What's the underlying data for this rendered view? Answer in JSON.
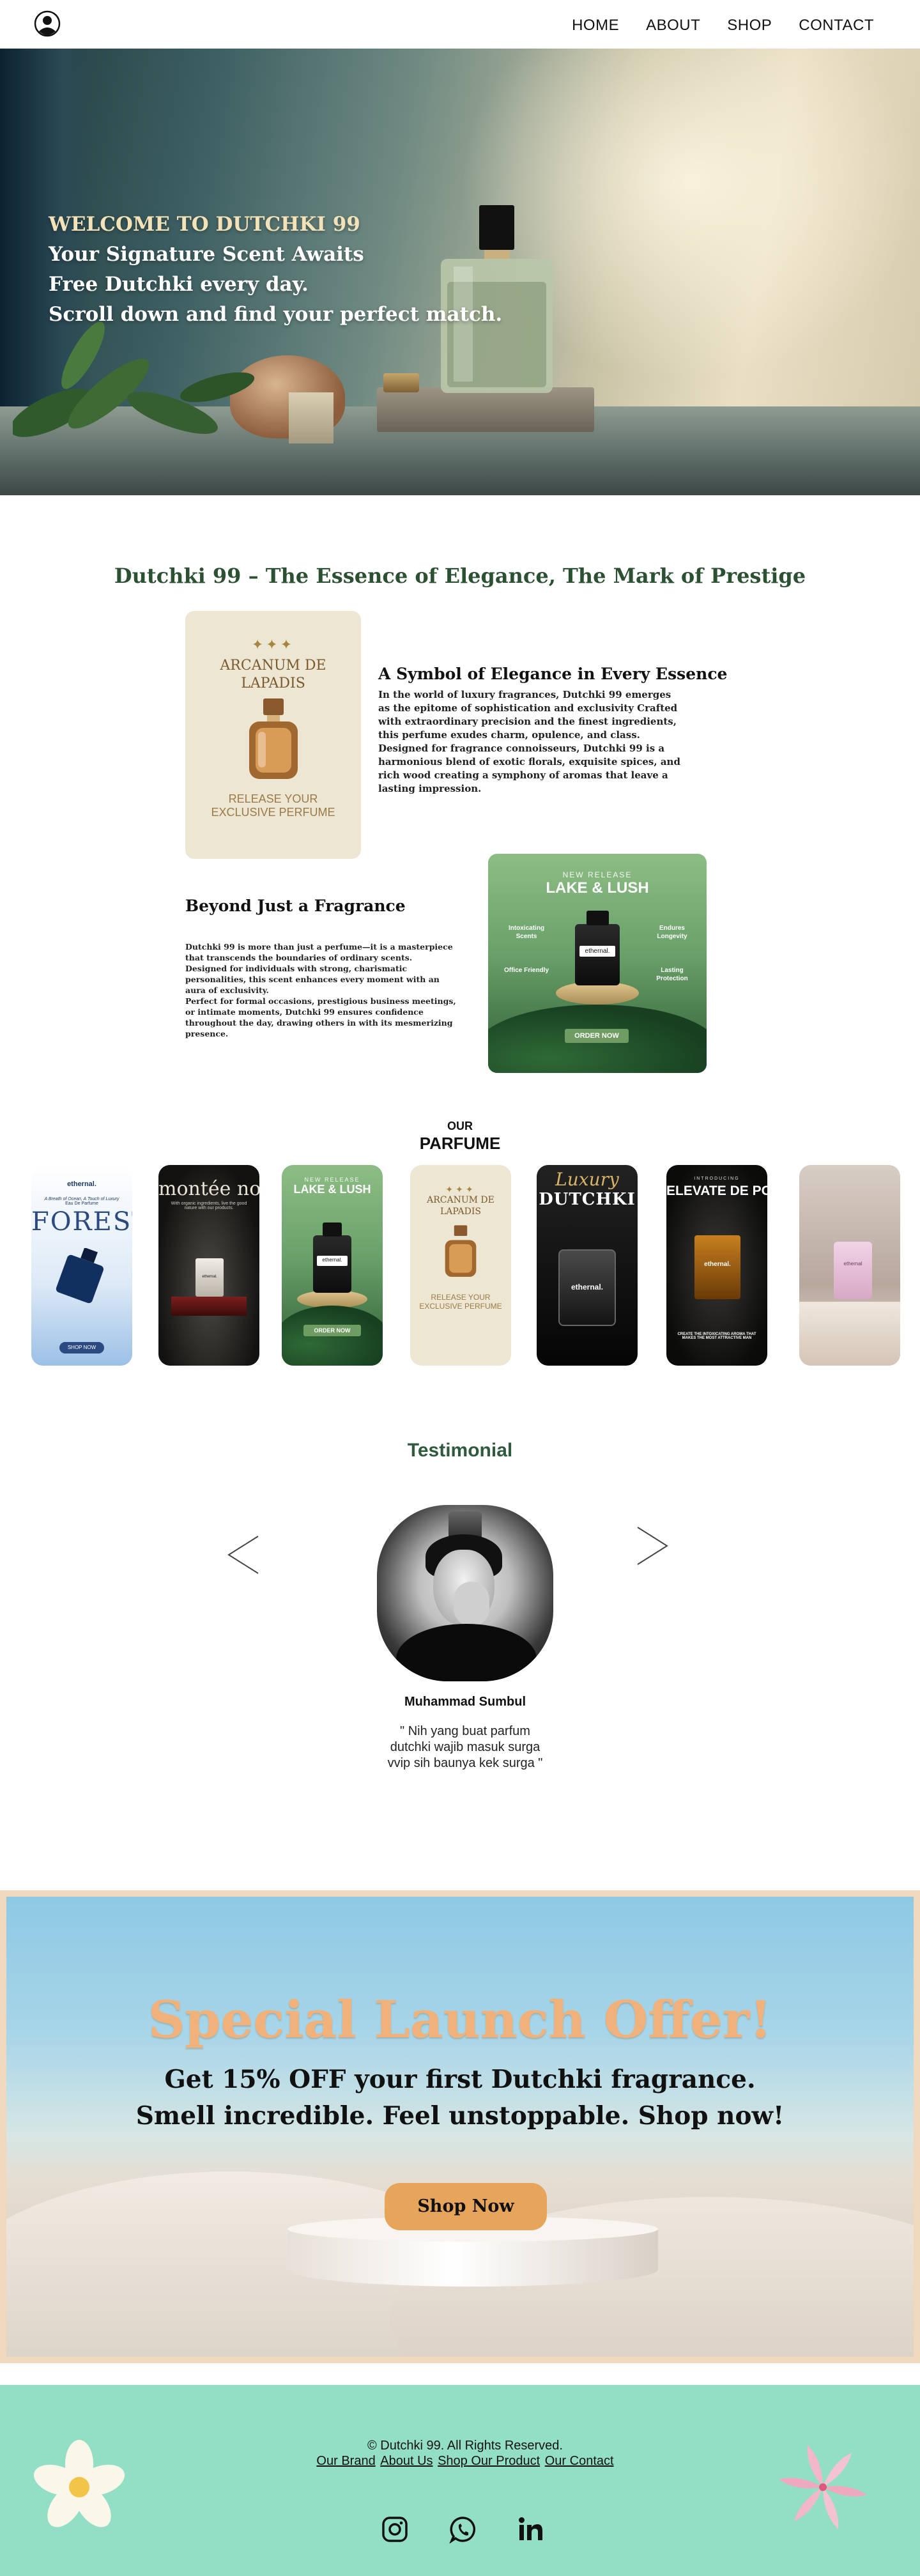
{
  "nav": {
    "items": [
      "HOME",
      "ABOUT",
      "SHOP",
      "CONTACT"
    ]
  },
  "hero": {
    "welcome": "WELCOME TO DUTCHKI 99",
    "line1": "Your Signature Scent Awaits",
    "line2": "Free Dutchki every day.",
    "line3": "Scroll down and find your perfect match."
  },
  "intro": {
    "title": "Dutchki 99 – The Essence of Elegance, The Mark of Prestige",
    "arcanum_card": {
      "stars": "✦✦✦",
      "name_line1": "ARCANUM DE",
      "name_line2": "LAPADIS",
      "tag_line1": "RELEASE YOUR",
      "tag_line2": "EXCLUSIVE PERFUME"
    },
    "symbol": {
      "heading": "A Symbol of Elegance in Every Essence",
      "lines": [
        "In the world of luxury fragrances, Dutchki 99 emerges",
        "as the epitome of sophistication and exclusivity Crafted",
        "with extraordinary precision and the finest ingredients,",
        "this perfume exudes charm, opulence, and class.",
        "Designed for fragrance connoisseurs, Dutchki 99 is a",
        "harmonious blend of exotic florals, exquisite spices, and",
        "rich wood creating a symphony of aromas that leave a",
        "lasting impression."
      ]
    },
    "beyond": {
      "heading": "Beyond Just a Fragrance",
      "lines": [
        "Dutchki 99 is more than just a perfume—it is a masterpiece",
        "that transcends the boundaries of ordinary scents.",
        "Designed for individuals with strong, charismatic",
        "personalities, this scent enhances every moment with an",
        "aura of exclusivity.",
        "Perfect for formal occasions, prestigious business meetings,",
        "or intimate moments, Dutchki 99 ensures confidence",
        "throughout the day, drawing others in with its mesmerizing",
        "presence."
      ]
    },
    "lake_card": {
      "new_release": "NEW RELEASE",
      "name": "LAKE & LUSH",
      "brand": "ethernal.",
      "features": [
        "Intoxicating Scents",
        "Endures Longevity",
        "Office Friendly",
        "Lasting Protection"
      ],
      "order": "ORDER NOW"
    }
  },
  "parfume": {
    "our": "OUR",
    "title": "PARFUME",
    "cards": [
      {
        "top": "ethernal.",
        "tagline": "A Breath of Ocean, A Touch of Luxury",
        "sub": "Eau De Parfume",
        "big": "FOREST",
        "brand": "ethernal.",
        "cta": "SHOP NOW"
      },
      {
        "big": "montée noir",
        "sub": "With organic ingredients, live the good nature with our products.",
        "brand": "ethernal."
      },
      {
        "top": "NEW RELEASE",
        "big": "LAKE & LUSH",
        "brand": "ethernal.",
        "cta": "ORDER NOW"
      },
      {
        "top": "✦✦✦",
        "big": "ARCANUM DE LAPADIS",
        "sub": "RELEASE YOUR EXCLUSIVE PERFUME"
      },
      {
        "top": "Luxury",
        "big": "DUTCHKI",
        "brand": "ethernal."
      },
      {
        "top": "INTRODUCING",
        "big": "ELEVATE DE PORQUE",
        "brand": "ethernal.",
        "sub": "CREATE THE INTOXICATING AROMA THAT MAKES THE MOST ATTRACTIVE MAN"
      },
      {
        "brand": "ethernal"
      }
    ]
  },
  "testimonial": {
    "title": "Testimonial",
    "name": "Muhammad Sumbul",
    "quote_line1": "\" Nih yang buat parfum",
    "quote_line2": "dutchki wajib masuk surga",
    "quote_line3": "vvip sih baunya kek surga \""
  },
  "promo": {
    "title": "Special Launch Offer!",
    "line1": "Get 15% OFF your first Dutchki fragrance.",
    "line2": "Smell incredible. Feel unstoppable. Shop now!",
    "button": "Shop Now",
    "accent": "#e7a45b"
  },
  "footer": {
    "copyright": "© Dutchki 99. All Rights Reserved.",
    "links": [
      "Our Brand",
      "About Us",
      "Shop Our Product",
      "Our Contact"
    ],
    "social": [
      "instagram-icon",
      "whatsapp-icon",
      "linkedin-icon"
    ],
    "bg": "#93dfc6"
  }
}
